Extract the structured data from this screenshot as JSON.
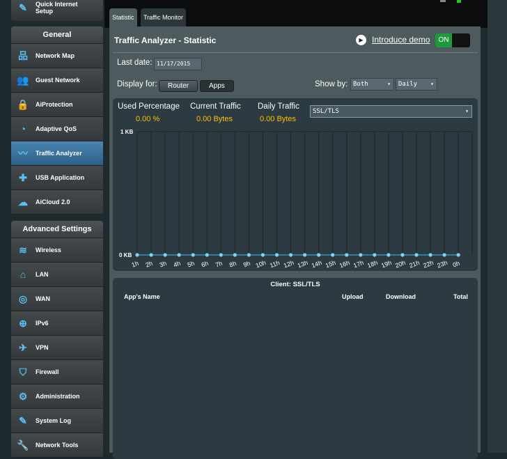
{
  "sidebar": {
    "quick_setup": "Quick Internet Setup",
    "general_header": "General",
    "general": [
      {
        "label": "Network Map",
        "icon": "network-map-icon"
      },
      {
        "label": "Guest Network",
        "icon": "guest-network-icon"
      },
      {
        "label": "AiProtection",
        "icon": "aiprotection-icon"
      },
      {
        "label": "Adaptive QoS",
        "icon": "qos-gauge-icon"
      },
      {
        "label": "Traffic Analyzer",
        "icon": "traffic-analyzer-icon",
        "selected": true
      },
      {
        "label": "USB Application",
        "icon": "usb-puzzle-icon"
      },
      {
        "label": "AiCloud 2.0",
        "icon": "cloud-icon"
      }
    ],
    "advanced_header": "Advanced Settings",
    "advanced": [
      {
        "label": "Wireless",
        "icon": "wifi-icon"
      },
      {
        "label": "LAN",
        "icon": "home-icon"
      },
      {
        "label": "WAN",
        "icon": "globe-icon"
      },
      {
        "label": "IPv6",
        "icon": "ipv6-icon"
      },
      {
        "label": "VPN",
        "icon": "vpn-icon"
      },
      {
        "label": "Firewall",
        "icon": "shield-icon"
      },
      {
        "label": "Administration",
        "icon": "admin-icon"
      },
      {
        "label": "System Log",
        "icon": "log-icon"
      },
      {
        "label": "Network Tools",
        "icon": "tools-icon"
      }
    ]
  },
  "tabs": [
    "Statistic",
    "Traffic Monitor"
  ],
  "header": {
    "title": "Traffic Analyzer - Statistic",
    "demo_link": "Introduce demo",
    "toggle": "ON"
  },
  "controls": {
    "last_date_label": "Last date:",
    "last_date": "11/17/2015",
    "display_for_label": "Display for:",
    "router": "Router",
    "apps": "Apps",
    "show_by_label": "Show by:",
    "show_by": "Both",
    "period": "Daily"
  },
  "stats": {
    "used_label": "Used Percentage",
    "used": "0.00 %",
    "current_label": "Current Traffic",
    "current": "0.00 Bytes",
    "daily_label": "Daily Traffic",
    "daily": "0.00 Bytes",
    "app_select": "SSL/TLS"
  },
  "chart_data": {
    "type": "line",
    "y_ticks": [
      "1 KB",
      "0 KB"
    ],
    "ylim": [
      0,
      1
    ],
    "categories": [
      "1h",
      "2h",
      "3h",
      "4h",
      "5h",
      "6h",
      "7h",
      "8h",
      "9h",
      "10h",
      "11h",
      "12h",
      "13h",
      "14h",
      "15h",
      "16h",
      "17h",
      "18h",
      "19h",
      "20h",
      "21h",
      "22h",
      "23h",
      "0h"
    ],
    "values": [
      0,
      0,
      0,
      0,
      0,
      0,
      0,
      0,
      0,
      0,
      0,
      0,
      0,
      0,
      0,
      0,
      0,
      0,
      0,
      0,
      0,
      0,
      0,
      0
    ],
    "point_color": "#7fd4f5",
    "grid": true
  },
  "table": {
    "title": "Client: SSL/TLS",
    "columns": [
      "App's Name",
      "Upload",
      "Download",
      "Total"
    ]
  }
}
